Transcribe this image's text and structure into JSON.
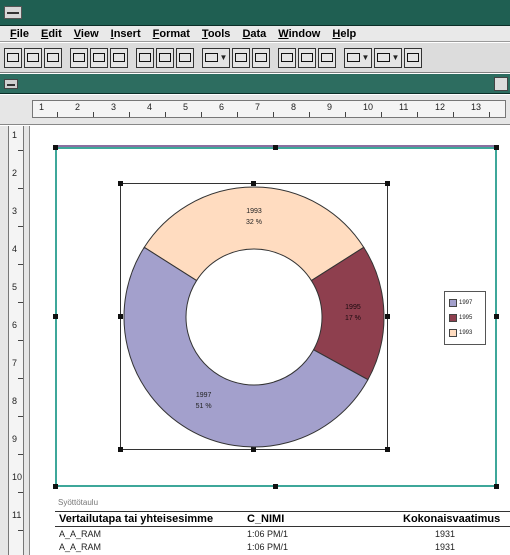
{
  "menubar": [
    "File",
    "Edit",
    "View",
    "Insert",
    "Format",
    "Tools",
    "Data",
    "Window",
    "Help"
  ],
  "ruler_h": [
    "1",
    "2",
    "3",
    "4",
    "5",
    "6",
    "7",
    "8",
    "9",
    "10",
    "11",
    "12",
    "13"
  ],
  "ruler_v": [
    "1",
    "2",
    "3",
    "4",
    "5",
    "6",
    "7",
    "8",
    "9",
    "10",
    "11"
  ],
  "chart_data": {
    "type": "pie",
    "categories": [
      "1993",
      "1995",
      "1997"
    ],
    "values": [
      32,
      17,
      51
    ],
    "data_labels": [
      {
        "series": "1993",
        "percent": "32 %"
      },
      {
        "series": "1995",
        "percent": "17 %"
      },
      {
        "series": "1997",
        "percent": "51 %"
      }
    ],
    "legend_position": "right",
    "legend": [
      "1993",
      "1995",
      "1997"
    ],
    "colors": [
      "#ffdcc0",
      "#8e3f4e",
      "#a3a0cc"
    ]
  },
  "table": {
    "caption": "Syöttötaulu",
    "headers": [
      "Vertailutapa tai yhteisesimme",
      "C_NIMI",
      "Kokonaisvaatimus"
    ],
    "rows": [
      [
        "A_A_RAM",
        "1:06 PM/1",
        "1931"
      ],
      [
        "A_A_RAM",
        "1:06 PM/1",
        "1931"
      ]
    ]
  }
}
